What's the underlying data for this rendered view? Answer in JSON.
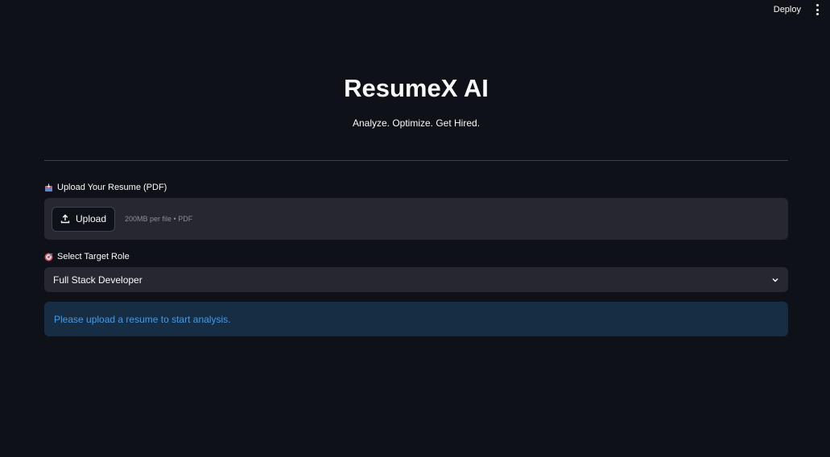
{
  "header": {
    "deploy_label": "Deploy",
    "menu_icon": "kebab-menu-icon"
  },
  "page": {
    "title": "ResumeX AI",
    "subtitle": "Analyze. Optimize. Get Hired."
  },
  "uploader": {
    "label": "Upload Your Resume (PDF)",
    "label_icon": "inbox-tray-icon",
    "button_label": "Upload",
    "limit_text": "200MB per file • PDF"
  },
  "role_select": {
    "label": "Select Target Role",
    "label_icon": "target-icon",
    "selected": "Full Stack Developer"
  },
  "info": {
    "message": "Please upload a resume to start analysis."
  },
  "colors": {
    "background": "#0e1117",
    "widget": "#262730",
    "info_bg": "#172d43",
    "info_text": "#3d9df3"
  }
}
